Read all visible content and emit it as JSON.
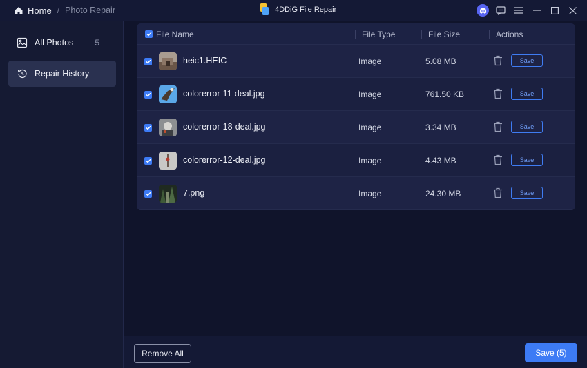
{
  "breadcrumb": {
    "home": "Home",
    "separator": "/",
    "current": "Photo Repair"
  },
  "app": {
    "title": "4DDiG File Repair"
  },
  "sidebar": {
    "items": [
      {
        "label": "All Photos",
        "count": "5",
        "icon": "image-icon"
      },
      {
        "label": "Repair History",
        "icon": "history-icon"
      }
    ]
  },
  "table": {
    "headers": {
      "name": "File Name",
      "type": "File Type",
      "size": "File Size",
      "actions": "Actions"
    },
    "rows": [
      {
        "name": "heic1.HEIC",
        "type": "Image",
        "size": "5.08 MB",
        "save": "Save",
        "checked": true
      },
      {
        "name": "colorerror-11-deal.jpg",
        "type": "Image",
        "size": "761.50 KB",
        "save": "Save",
        "checked": true
      },
      {
        "name": "colorerror-18-deal.jpg",
        "type": "Image",
        "size": "3.34 MB",
        "save": "Save",
        "checked": true
      },
      {
        "name": "colorerror-12-deal.jpg",
        "type": "Image",
        "size": "4.43 MB",
        "save": "Save",
        "checked": true
      },
      {
        "name": "7.png",
        "type": "Image",
        "size": "24.30 MB",
        "save": "Save",
        "checked": true
      }
    ]
  },
  "footer": {
    "remove_all": "Remove All",
    "save_all": "Save (5)"
  },
  "colors": {
    "accent": "#3d7bf5",
    "background": "#10142b",
    "discord": "#5865f2"
  }
}
